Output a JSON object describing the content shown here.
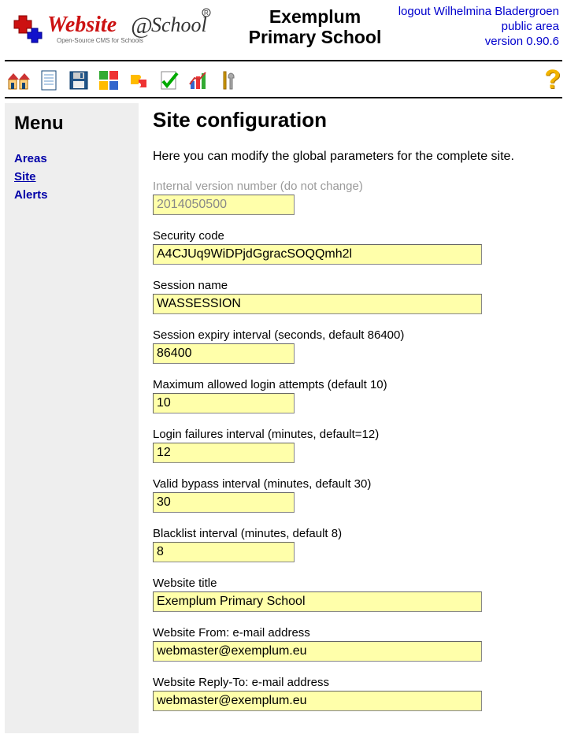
{
  "header": {
    "school_line1": "Exemplum",
    "school_line2": "Primary School",
    "logout_label": "logout",
    "user_name": "Wilhelmina Bladergroen",
    "public_area": "public area",
    "version_label": "version 0.90.6"
  },
  "toolbar": {
    "items": [
      "home-icon",
      "page-icon",
      "save-icon",
      "modules-icon",
      "puzzle-icon",
      "check-icon",
      "stats-icon",
      "tools-icon"
    ],
    "help": "?"
  },
  "sidebar": {
    "title": "Menu",
    "items": [
      {
        "label": "Areas",
        "current": false
      },
      {
        "label": "Site",
        "current": true
      },
      {
        "label": "Alerts",
        "current": false
      }
    ]
  },
  "main": {
    "title": "Site configuration",
    "intro": "Here you can modify the global parameters for the complete site.",
    "fields": [
      {
        "label": "Internal version number (do not change)",
        "value": "2014050500",
        "size": "small",
        "disabled": true
      },
      {
        "label": "Security code",
        "value": "A4CJUq9WiDPjdGgracSOQQmh2l",
        "size": "wide",
        "disabled": false
      },
      {
        "label": "Session name",
        "value": "WASSESSION",
        "size": "wide",
        "disabled": false
      },
      {
        "label": "Session expiry interval (seconds, default 86400)",
        "value": "86400",
        "size": "small",
        "disabled": false
      },
      {
        "label": "Maximum allowed login attempts (default 10)",
        "value": "10",
        "size": "small",
        "disabled": false
      },
      {
        "label": "Login failures interval (minutes, default=12)",
        "value": "12",
        "size": "small",
        "disabled": false
      },
      {
        "label": "Valid bypass interval (minutes, default 30)",
        "value": "30",
        "size": "small",
        "disabled": false
      },
      {
        "label": "Blacklist interval (minutes, default 8)",
        "value": "8",
        "size": "small",
        "disabled": false
      },
      {
        "label": "Website title",
        "value": "Exemplum Primary School",
        "size": "wide",
        "disabled": false
      },
      {
        "label": "Website From: e-mail address",
        "value": "webmaster@exemplum.eu",
        "size": "wide",
        "disabled": false
      },
      {
        "label": "Website Reply-To: e-mail address",
        "value": "webmaster@exemplum.eu",
        "size": "wide",
        "disabled": false
      }
    ]
  }
}
